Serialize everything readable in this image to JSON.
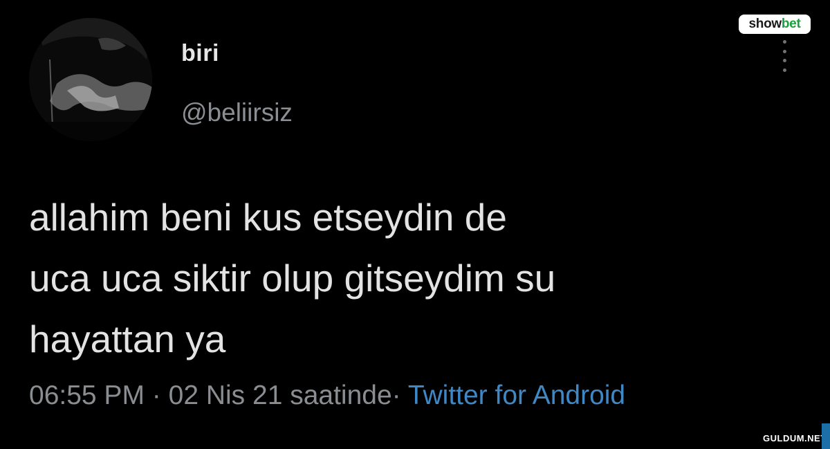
{
  "brand": {
    "part1": "show",
    "part2": "bet",
    "accent_color": "#1e9e3e"
  },
  "tweet": {
    "display_name": "biri",
    "handle": "@beliirsiz",
    "avatar_icon": "avatar-photo",
    "text_lines": [
      "allahim beni kus etseydin de",
      "uca uca siktir olup gitseydim su",
      "hayattan ya"
    ],
    "time": "06:55 PM",
    "separator": "·",
    "date": "02 Nis 21 saatinde",
    "source_separator": "·",
    "source": "Twitter for Android",
    "source_color": "#3f88c5"
  },
  "menu": {
    "icon": "more-vertical-icon"
  },
  "watermark": {
    "text": "GULDUM.NET"
  }
}
